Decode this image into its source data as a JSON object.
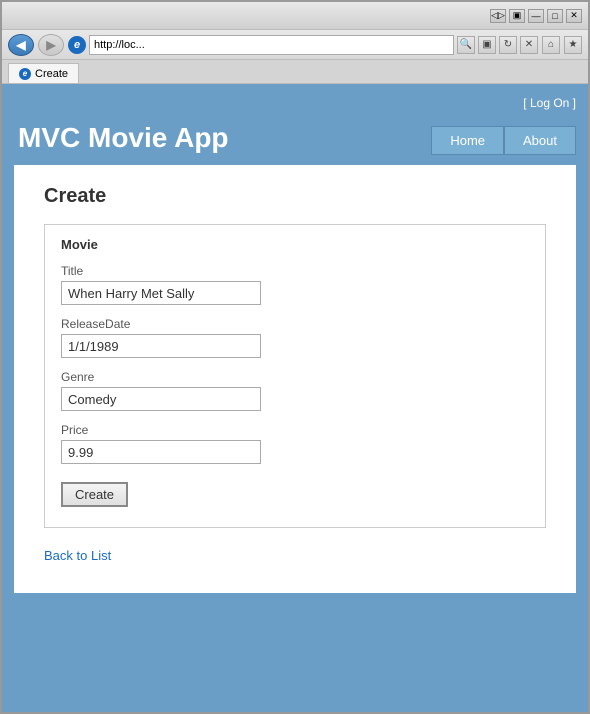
{
  "browser": {
    "url": "http://loc...",
    "tab_title": "Create",
    "back_arrow": "◀",
    "forward_arrow": "▶",
    "refresh": "↻",
    "stop": "✕",
    "search_placeholder": "🔍",
    "title_controls": [
      "▣",
      "—",
      "□",
      "✕"
    ]
  },
  "app": {
    "title": "MVC Movie App",
    "logon_label": "[ Log On ]",
    "nav": {
      "home": "Home",
      "about": "About"
    },
    "page_title": "Create",
    "form": {
      "section_title": "Movie",
      "fields": [
        {
          "label": "Title",
          "value": "When Harry Met Sally",
          "name": "title-input"
        },
        {
          "label": "ReleaseDate",
          "value": "1/1/1989",
          "name": "releasedate-input"
        },
        {
          "label": "Genre",
          "value": "Comedy",
          "name": "genre-input"
        },
        {
          "label": "Price",
          "value": "9.99",
          "name": "price-input"
        }
      ],
      "submit_label": "Create"
    },
    "back_link": "Back to List"
  }
}
